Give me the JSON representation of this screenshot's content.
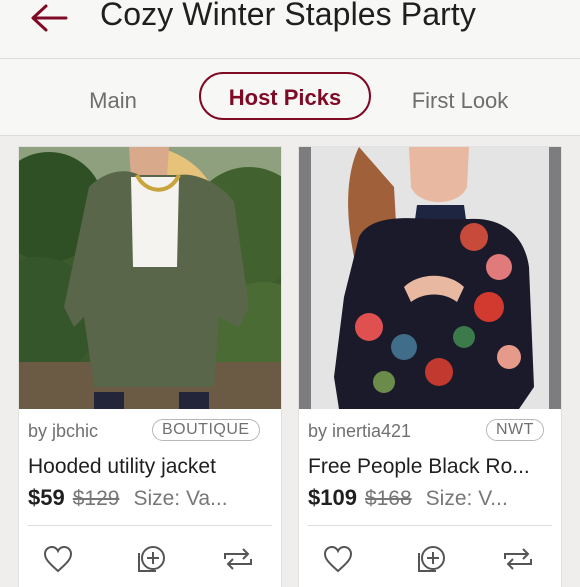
{
  "header": {
    "title": "Cozy Winter Staples Party",
    "back_icon": "back-arrow-icon",
    "accent": "#7f0a25"
  },
  "tabs": [
    {
      "label": "Main",
      "active": false
    },
    {
      "label": "Host Picks",
      "active": true
    },
    {
      "label": "First Look",
      "active": false
    }
  ],
  "listings": [
    {
      "seller": "by jbchic",
      "badge": "BOUTIQUE",
      "title": "Hooded utility jacket",
      "price": "$59",
      "original_price": "$129",
      "size": "Size: Va..."
    },
    {
      "seller": "by inertia421",
      "badge": "NWT",
      "title": "Free People Black Ro...",
      "price": "$109",
      "original_price": "$168",
      "size": "Size: V..."
    }
  ],
  "actions": {
    "like_icon": "heart-icon",
    "bundle_icon": "add-to-bundle-icon",
    "share_icon": "share-icon"
  }
}
